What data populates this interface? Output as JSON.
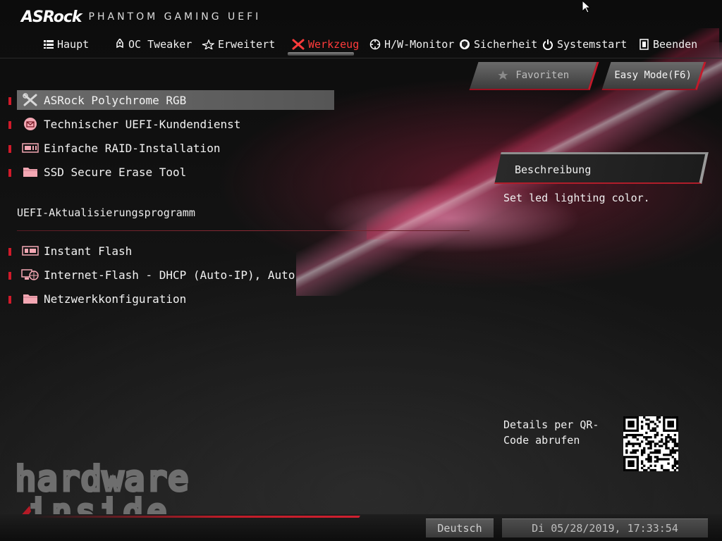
{
  "header": {
    "brand": "ASRock",
    "subtitle": "PHANTOM GAMING UEFI"
  },
  "tabs": [
    {
      "label": "Haupt",
      "icon": "list-icon"
    },
    {
      "label": "OC Tweaker",
      "icon": "rocket-icon"
    },
    {
      "label": "Erweitert",
      "icon": "star-icon"
    },
    {
      "label": "Werkzeug",
      "icon": "tools-icon",
      "active": true
    },
    {
      "label": "H/W-Monitor",
      "icon": "crosshair-icon"
    },
    {
      "label": "Sicherheit",
      "icon": "shield-icon"
    },
    {
      "label": "Systemstart",
      "icon": "power-icon"
    },
    {
      "label": "Beenden",
      "icon": "exit-icon"
    }
  ],
  "buttons": {
    "favorites": "Favoriten",
    "easy_mode": "Easy Mode(F6)"
  },
  "tools": [
    {
      "label": "ASRock Polychrome RGB",
      "icon": "tools-icon",
      "selected": true
    },
    {
      "label": "Technischer UEFI-Kundendienst",
      "icon": "mail-icon"
    },
    {
      "label": "Einfache RAID-Installation",
      "icon": "raid-drive-icon"
    },
    {
      "label": "SSD Secure Erase Tool",
      "icon": "folder-icon"
    }
  ],
  "update_section": {
    "title": "UEFI-Aktualisierungsprogramm",
    "items": [
      {
        "label": "Instant Flash",
        "icon": "bios-chip-icon"
      },
      {
        "label": "Internet-Flash - DHCP (Auto-IP), Auto",
        "icon": "globe-network-icon"
      },
      {
        "label": "Netzwerkkonfiguration",
        "icon": "folder-icon"
      }
    ]
  },
  "description": {
    "title": "Beschreibung",
    "text": "Set led lighting color."
  },
  "qr": {
    "label": "Details per QR-Code abrufen"
  },
  "watermark": {
    "line1": "hardware",
    "line2": "inside"
  },
  "footer": {
    "language": "Deutsch",
    "datetime": "Di 05/28/2019, 17:33:54"
  },
  "colors": {
    "accent_red": "#d11a2a",
    "active_tab": "#ff3b3b",
    "selected_row": "#656565"
  }
}
